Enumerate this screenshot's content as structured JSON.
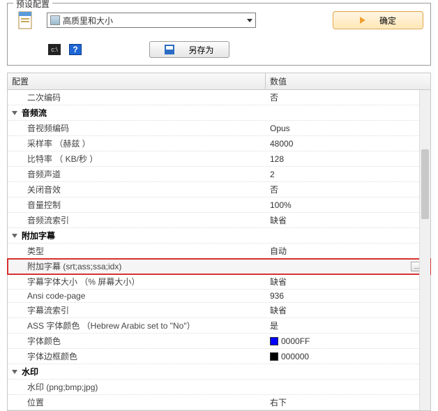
{
  "panel": {
    "title": "预设配置"
  },
  "dropdown": {
    "selected": "高质里和大小"
  },
  "ok": {
    "label": "确定"
  },
  "saveas": {
    "label": "另存为"
  },
  "grid": {
    "header": {
      "left": "配置",
      "right": "数值"
    },
    "rows": [
      {
        "type": "item",
        "label": "二次编码",
        "value": "否"
      },
      {
        "type": "group",
        "label": "音频流"
      },
      {
        "type": "item",
        "label": "音视频编码",
        "value": "Opus"
      },
      {
        "type": "item",
        "label": "采样率 （赫兹 ）",
        "value": "48000"
      },
      {
        "type": "item",
        "label": "比特率 （ KB/秒 ）",
        "value": "128"
      },
      {
        "type": "item",
        "label": "音频声道",
        "value": "2"
      },
      {
        "type": "item",
        "label": "关闭音效",
        "value": "否"
      },
      {
        "type": "item",
        "label": "音量控制",
        "value": "100%"
      },
      {
        "type": "item",
        "label": "音频流索引",
        "value": "缺省"
      },
      {
        "type": "group",
        "label": "附加字幕"
      },
      {
        "type": "item",
        "label": "类型",
        "value": "自动"
      },
      {
        "type": "hl",
        "label": "附加字幕 (srt;ass;ssa;idx)",
        "value": ""
      },
      {
        "type": "item",
        "label": "字幕字体大小 （% 屏幕大小）",
        "value": "缺省"
      },
      {
        "type": "item",
        "label": "Ansi code-page",
        "value": "936"
      },
      {
        "type": "item",
        "label": "字幕流索引",
        "value": "缺省"
      },
      {
        "type": "item",
        "label": "ASS 字体颜色 （Hebrew Arabic set to \"No\"）",
        "value": "是"
      },
      {
        "type": "color",
        "label": "字体颜色",
        "value": "0000FF",
        "hex": "#0000FF"
      },
      {
        "type": "color",
        "label": "字体边框颜色",
        "value": "000000",
        "hex": "#000000"
      },
      {
        "type": "group",
        "label": "水印"
      },
      {
        "type": "item",
        "label": "水印 (png;bmp;jpg)",
        "value": ""
      },
      {
        "type": "item",
        "label": "位置",
        "value": "右下"
      }
    ]
  }
}
